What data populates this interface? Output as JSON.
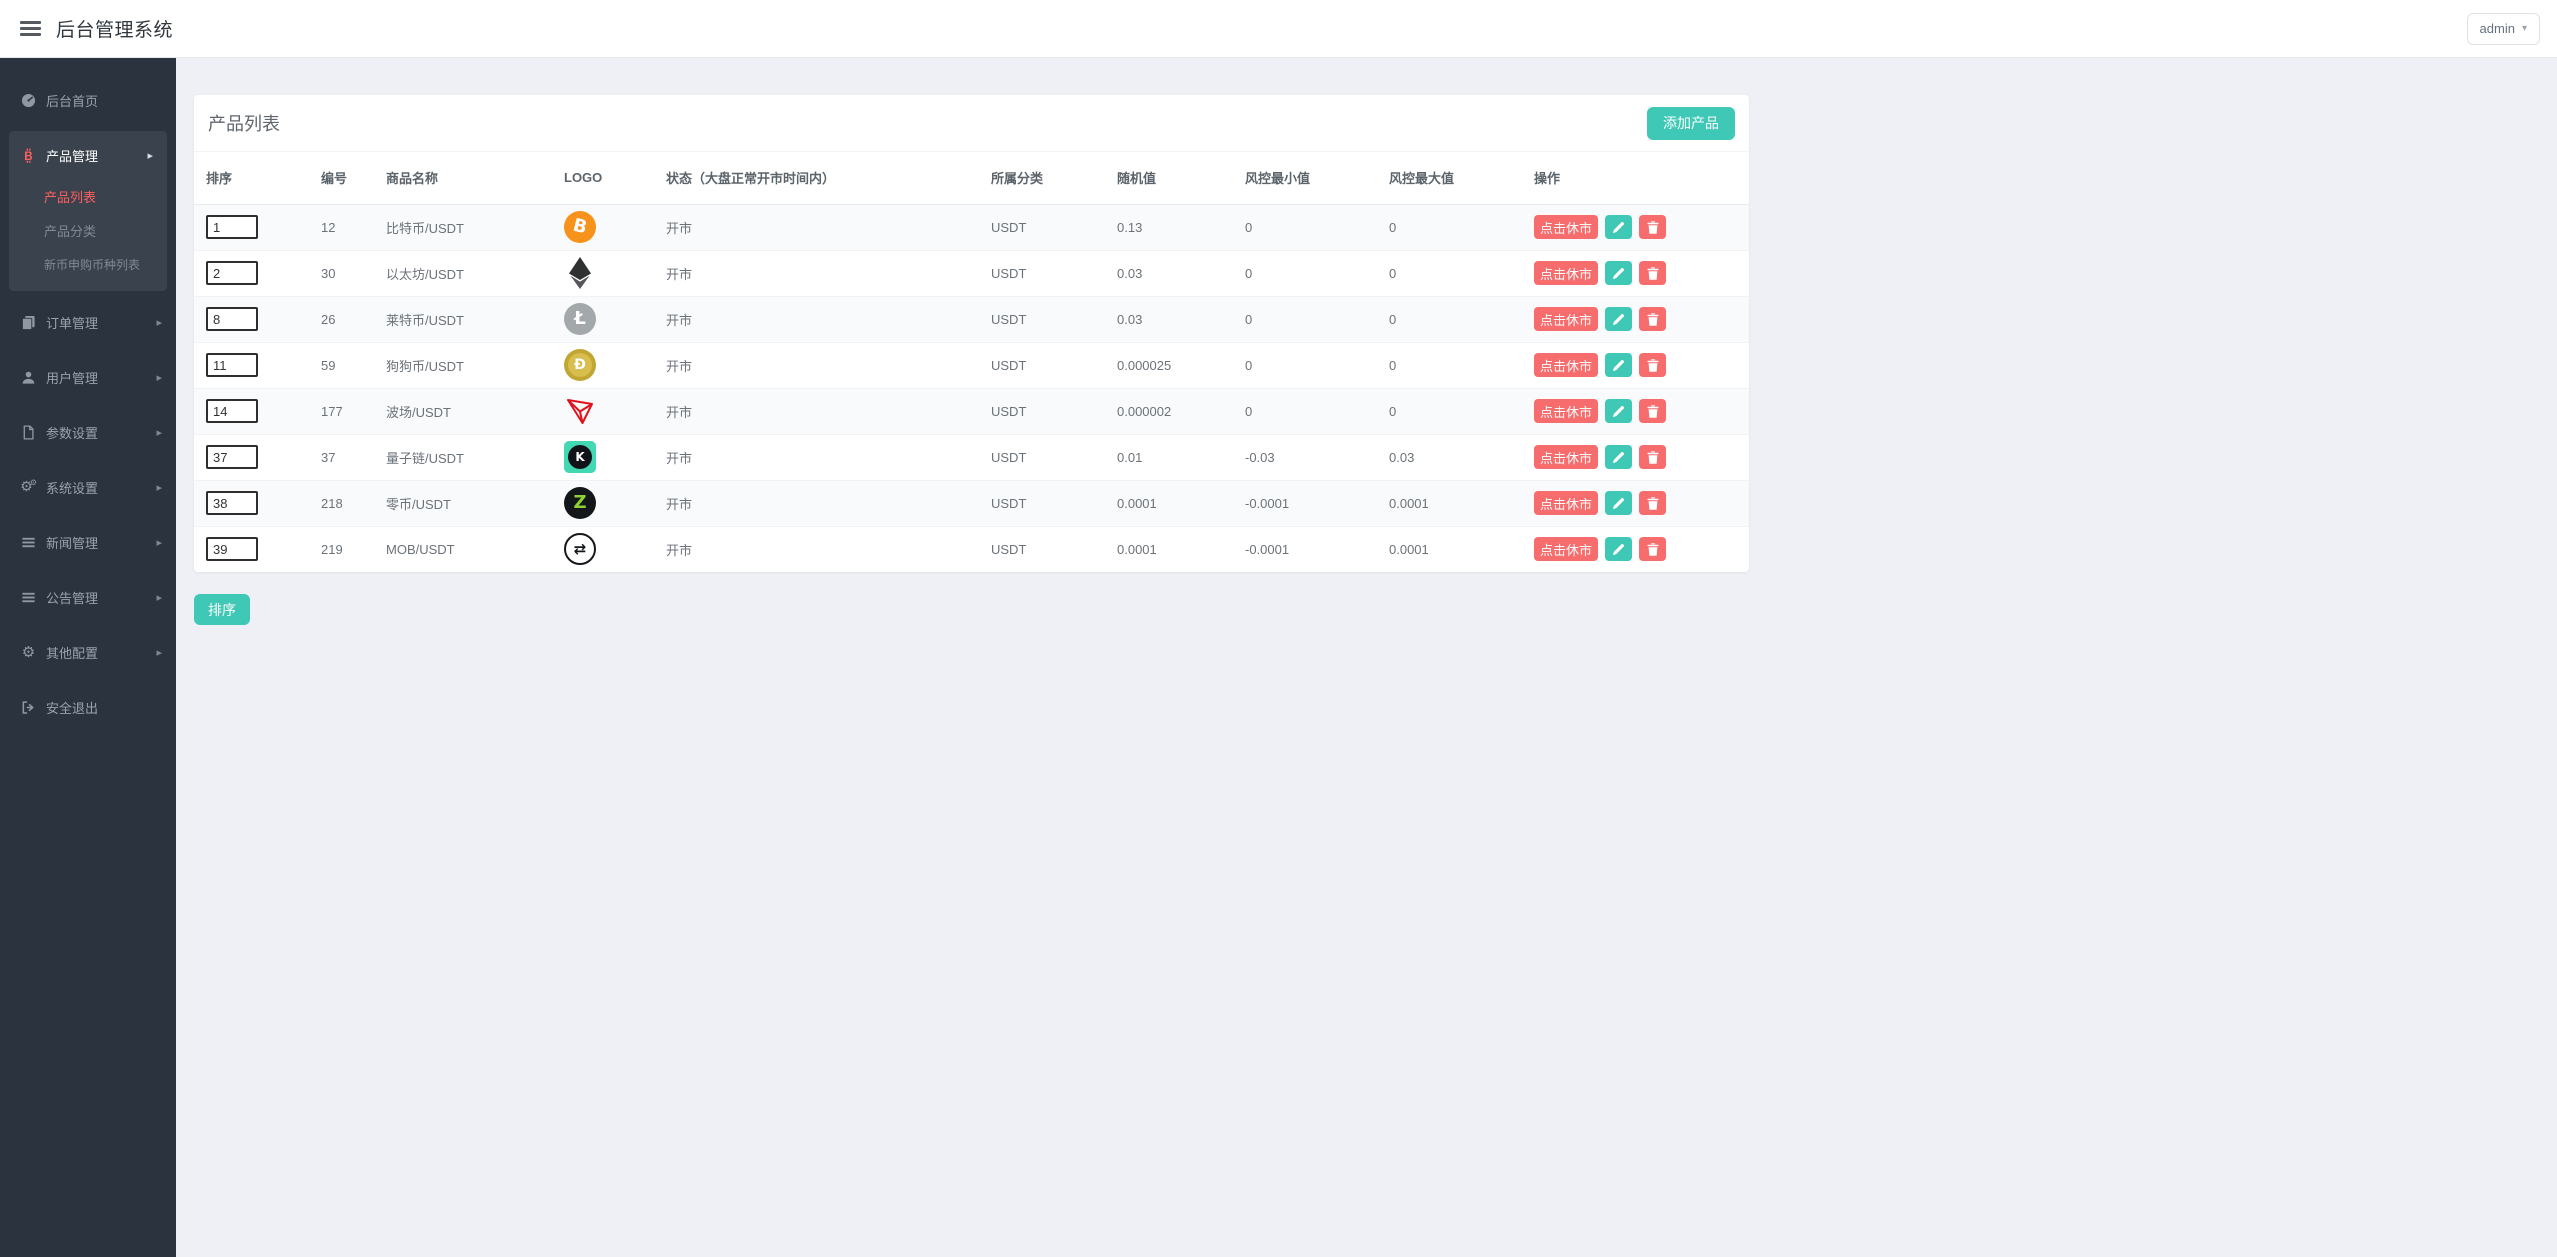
{
  "header": {
    "title": "后台管理系统",
    "user_menu": "admin"
  },
  "icons": {
    "caret_right": "▸",
    "caret_down": "▾",
    "gear": "⚙"
  },
  "colors": {
    "teal": "#3ec8b5",
    "danger": "#f76c6c",
    "sidebar_bg": "#2b333e",
    "active_red": "#ff5f5f",
    "content_bg": "#eef0f5"
  },
  "sidebar": {
    "items": [
      {
        "label": "后台首页",
        "icon": "dashboard-icon"
      },
      {
        "label": "产品管理",
        "icon": "bitcoin-icon",
        "active": true,
        "children": [
          {
            "label": "产品列表",
            "active": true
          },
          {
            "label": "产品分类"
          },
          {
            "label": "新币申购币种列表"
          }
        ]
      },
      {
        "label": "订单管理",
        "icon": "orders-icon"
      },
      {
        "label": "用户管理",
        "icon": "user-icon"
      },
      {
        "label": "参数设置",
        "icon": "document-icon"
      },
      {
        "label": "系统设置",
        "icon": "gears-icon"
      },
      {
        "label": "新闻管理",
        "icon": "list-icon"
      },
      {
        "label": "公告管理",
        "icon": "list-icon"
      },
      {
        "label": "其他配置",
        "icon": "gear-icon"
      },
      {
        "label": "安全退出",
        "icon": "logout-icon"
      }
    ]
  },
  "page": {
    "card_title": "产品列表",
    "add_button_label": "添加产品",
    "sort_button_label": "排序",
    "table": {
      "columns": [
        "排序",
        "编号",
        "商品名称",
        "LOGO",
        "状态（大盘正常开市时间内）",
        "所属分类",
        "随机值",
        "风控最小值",
        "风控最大值",
        "操作"
      ],
      "actions": {
        "close_label": "点击休市",
        "edit": "edit",
        "delete": "delete"
      },
      "rows": [
        {
          "sort": "1",
          "code": "12",
          "name": "比特币/USDT",
          "status": "开市",
          "category": "USDT",
          "random": "0.13",
          "risk_min": "0",
          "risk_max": "0",
          "logo": {
            "name": "bitcoin",
            "shape": "circle",
            "bg": "#f7931a",
            "fg": "#ffffff",
            "glyph": "B",
            "size": 18,
            "tilt": 14
          }
        },
        {
          "sort": "2",
          "code": "30",
          "name": "以太坊/USDT",
          "status": "开市",
          "category": "USDT",
          "random": "0.03",
          "risk_min": "0",
          "risk_max": "0",
          "logo": {
            "name": "ethereum",
            "shape": "eth",
            "top": "#2f3030",
            "bottom": "#55555a"
          }
        },
        {
          "sort": "8",
          "code": "26",
          "name": "莱特币/USDT",
          "status": "开市",
          "category": "USDT",
          "random": "0.03",
          "risk_min": "0",
          "risk_max": "0",
          "logo": {
            "name": "litecoin",
            "shape": "circle",
            "bg": "#a3a8ab",
            "fg": "#ffffff",
            "glyph": "Ł",
            "size": 18
          }
        },
        {
          "sort": "11",
          "code": "59",
          "name": "狗狗币/USDT",
          "status": "开市",
          "category": "USDT",
          "random": "0.000025",
          "risk_min": "0",
          "risk_max": "0",
          "logo": {
            "name": "dogecoin",
            "shape": "circle",
            "bg": "#c2a633",
            "inner": "#d8bd4f",
            "fg": "#ffffff",
            "glyph": "Ð",
            "size": 14
          }
        },
        {
          "sort": "14",
          "code": "177",
          "name": "波场/USDT",
          "status": "开市",
          "category": "USDT",
          "random": "0.000002",
          "risk_min": "0",
          "risk_max": "0",
          "logo": {
            "name": "tron",
            "shape": "tron",
            "stroke": "#e0121c"
          }
        },
        {
          "sort": "37",
          "code": "37",
          "name": "量子链/USDT",
          "status": "开市",
          "category": "USDT",
          "random": "0.01",
          "risk_min": "-0.03",
          "risk_max": "0.03",
          "logo": {
            "name": "qtum-k",
            "shape": "square-k",
            "bg": "#41d8b2",
            "circle": "#101418",
            "fg": "#ffffff",
            "glyph": "K",
            "size": 12
          }
        },
        {
          "sort": "38",
          "code": "218",
          "name": "零币/USDT",
          "status": "开市",
          "category": "USDT",
          "random": "0.0001",
          "risk_min": "-0.0001",
          "risk_max": "0.0001",
          "logo": {
            "name": "zcash",
            "shape": "circle",
            "bg": "#14171a",
            "fg": "#8fd133",
            "glyph": "Z",
            "size": 18
          }
        },
        {
          "sort": "39",
          "code": "219",
          "name": "MOB/USDT",
          "status": "开市",
          "category": "USDT",
          "random": "0.0001",
          "risk_min": "-0.0001",
          "risk_max": "0.0001",
          "logo": {
            "name": "mob",
            "shape": "circle",
            "bg": "#ffffff",
            "border": "#15181b",
            "fg": "#15181b",
            "glyph": "⇄",
            "size": 15
          }
        }
      ]
    }
  }
}
